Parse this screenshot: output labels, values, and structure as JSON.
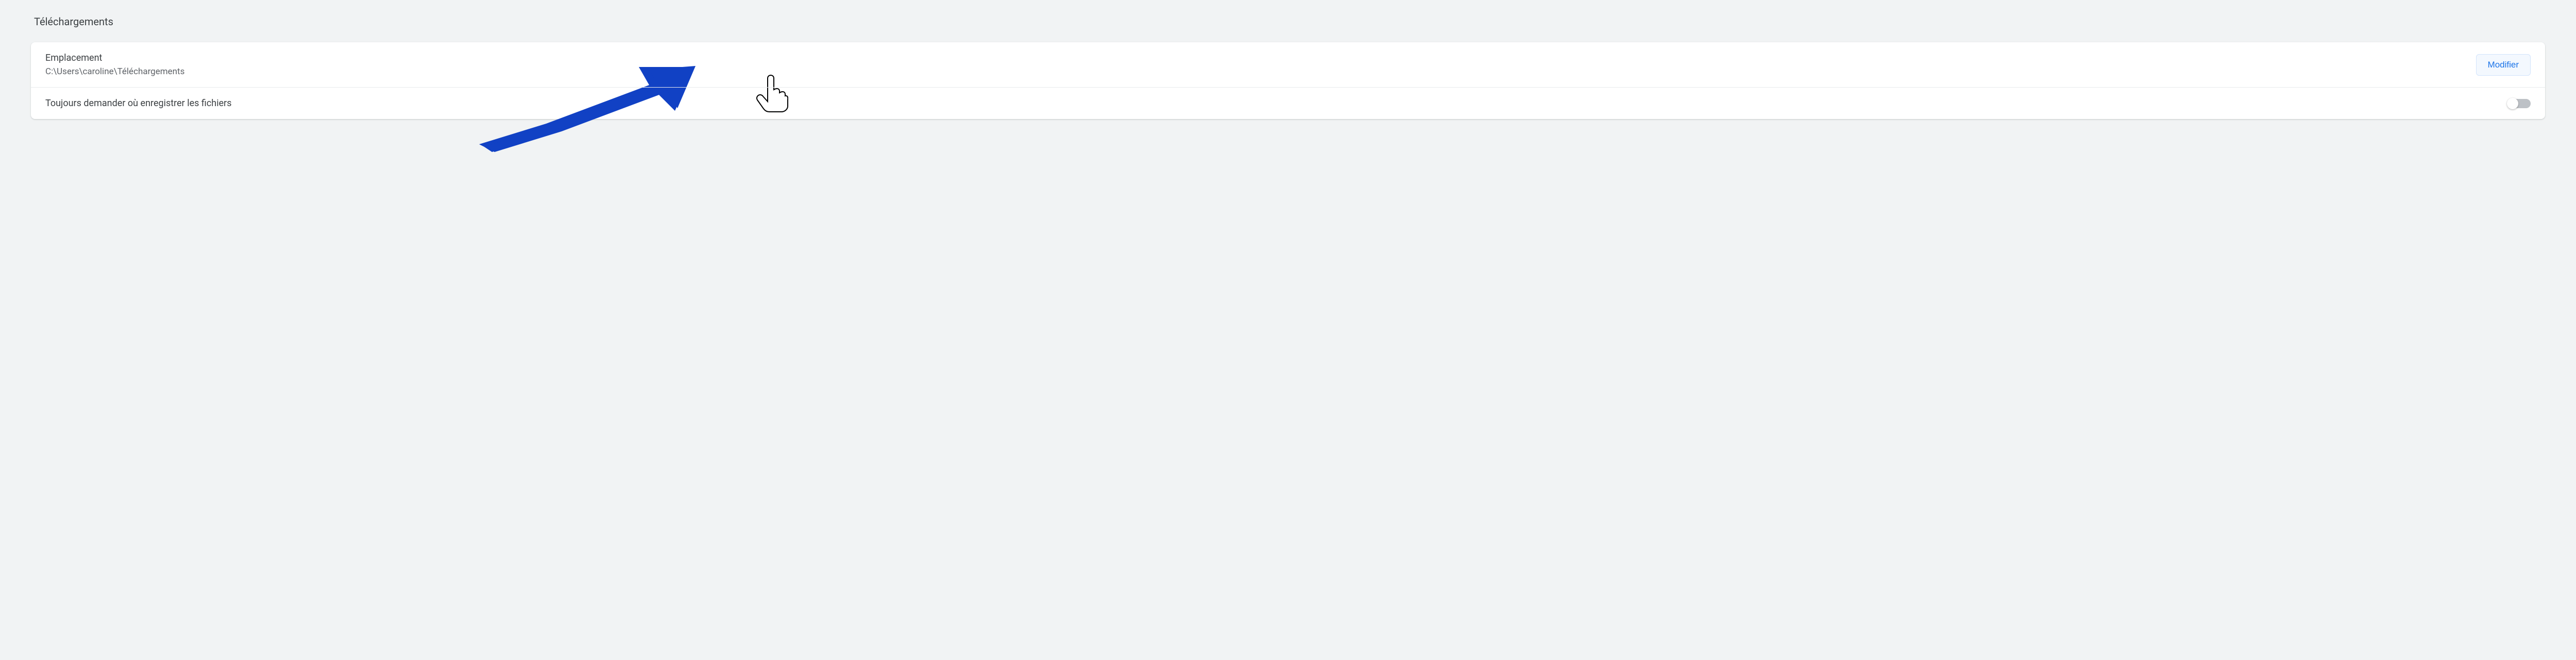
{
  "section": {
    "title": "Téléchargements"
  },
  "location": {
    "label": "Emplacement",
    "path": "C:\\Users\\caroline\\Téléchargements",
    "button_label": "Modifier"
  },
  "ask_location": {
    "label": "Toujours demander où enregistrer les fichiers",
    "enabled": false
  }
}
